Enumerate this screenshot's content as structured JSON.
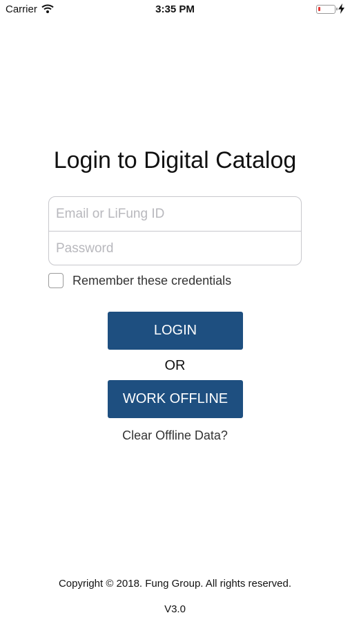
{
  "status_bar": {
    "carrier": "Carrier",
    "time": "3:35 PM",
    "battery_level": 0.12,
    "battery_color": "#e53935"
  },
  "login": {
    "title": "Login to Digital Catalog",
    "email_placeholder": "Email or LiFung ID",
    "password_placeholder": "Password",
    "remember_label": "Remember these credentials",
    "remember_checked": false,
    "login_button": "LOGIN",
    "or_text": "OR",
    "work_offline_button": "WORK OFFLINE",
    "clear_offline_link": "Clear Offline Data?",
    "button_color": "#1e4f80"
  },
  "footer": {
    "copyright": "Copyright © 2018. Fung Group. All rights reserved.",
    "version": "V3.0"
  }
}
